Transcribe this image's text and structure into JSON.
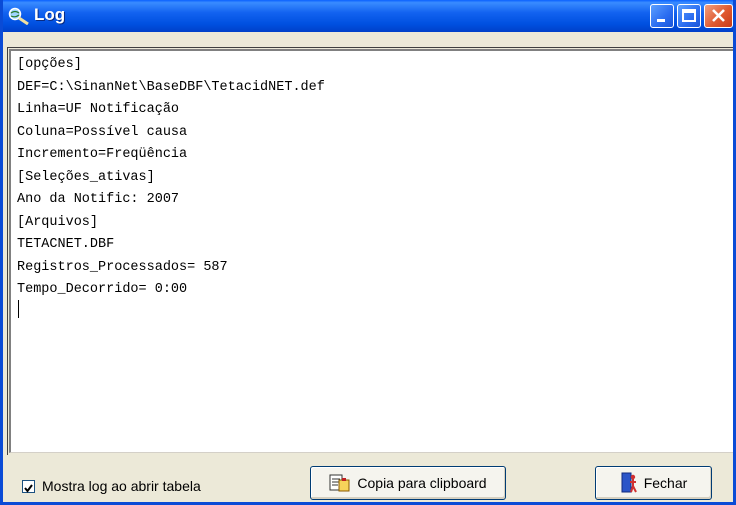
{
  "window": {
    "title": "Log"
  },
  "log": {
    "lines": [
      "[opções]",
      "DEF=C:\\SinanNet\\BaseDBF\\TetacidNET.def",
      "Linha=UF Notificação",
      "Coluna=Possível causa",
      "Incremento=Freqüência",
      "[Seleções_ativas]",
      "Ano da Notific: 2007",
      "[Arquivos]",
      "TETACNET.DBF",
      "Registros_Processados= 587",
      "Tempo_Decorrido= 0:00"
    ]
  },
  "footer": {
    "checkbox_label": "Mostra log ao abrir tabela",
    "checkbox_checked": true,
    "copy_button_label": "Copia para clipboard",
    "close_button_label": "Fechar"
  },
  "icons": {
    "title": "magnifier-globe-icon",
    "copy": "clipboard-copy-icon",
    "close": "door-exit-icon"
  }
}
